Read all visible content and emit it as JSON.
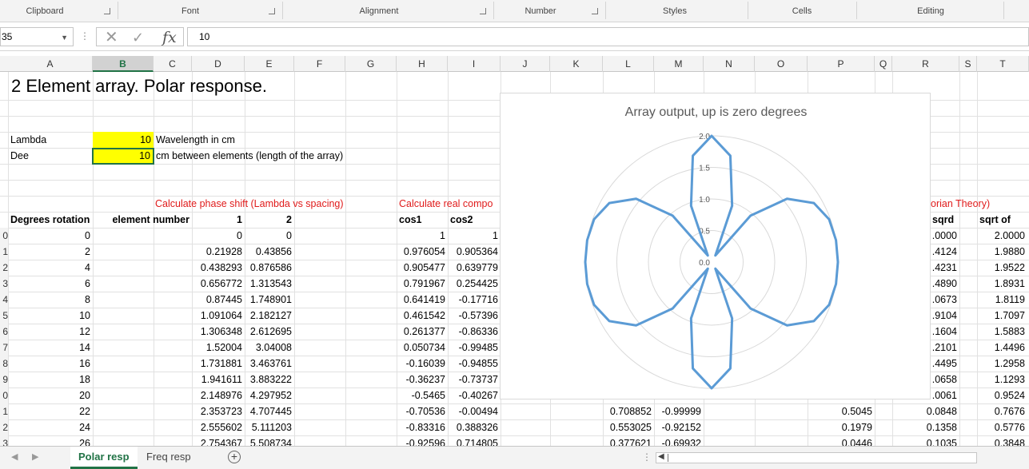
{
  "ribbon": {
    "groups": [
      "Clipboard",
      "Font",
      "Alignment",
      "Number",
      "Styles",
      "Cells",
      "Editing"
    ]
  },
  "formula_bar": {
    "name_box": "35",
    "value": "10",
    "fx": "fx"
  },
  "columns": [
    "A",
    "B",
    "C",
    "D",
    "E",
    "F",
    "G",
    "H",
    "I",
    "J",
    "K",
    "L",
    "M",
    "N",
    "O",
    "P",
    "Q",
    "R",
    "S",
    "T"
  ],
  "sheet": {
    "title": "2 Element array.  Polar response.",
    "lambda_label": "Lambda",
    "lambda_value": "10",
    "lambda_desc": "Wavelength in cm",
    "dee_label": "Dee",
    "dee_value": "10",
    "dee_desc": "cm between elements  (length of the array)",
    "phase_heading": "Calculate phase shift (Lambda vs spacing)",
    "real_heading": "Calculate real compo",
    "theory_heading": "orian Theory)",
    "headers": {
      "degrees": "Degrees rotation",
      "element": "element number",
      "d": "1",
      "e": "2",
      "h": "cos1",
      "i": "cos2",
      "r": "sqrd",
      "t": "sqrt of"
    },
    "row_numbers": [
      "0",
      "1",
      "2",
      "3",
      "4",
      "5",
      "6",
      "7",
      "8",
      "9",
      "0",
      "1",
      "2",
      "3"
    ],
    "rows": [
      {
        "a": "0",
        "d": "0",
        "e": "0",
        "h": "1",
        "i": "1",
        "l": "",
        "m": "",
        "p": "",
        "r": ".0000",
        "t": "2.0000"
      },
      {
        "a": "2",
        "d": "0.21928",
        "e": "0.43856",
        "h": "0.976054",
        "i": "0.905364",
        "l": "",
        "m": "",
        "p": "",
        "r": ".4124",
        "t": "1.9880"
      },
      {
        "a": "4",
        "d": "0.438293",
        "e": "0.876586",
        "h": "0.905477",
        "i": "0.639779",
        "l": "",
        "m": "",
        "p": "",
        "r": ".4231",
        "t": "1.9522"
      },
      {
        "a": "6",
        "d": "0.656772",
        "e": "1.313543",
        "h": "0.791967",
        "i": "0.254425",
        "l": "",
        "m": "",
        "p": "",
        "r": ".4890",
        "t": "1.8931"
      },
      {
        "a": "8",
        "d": "0.87445",
        "e": "1.748901",
        "h": "0.641419",
        "i": "-0.17716",
        "l": "",
        "m": "",
        "p": "",
        "r": ".0673",
        "t": "1.8119"
      },
      {
        "a": "10",
        "d": "1.091064",
        "e": "2.182127",
        "h": "0.461542",
        "i": "-0.57396",
        "l": "",
        "m": "",
        "p": "",
        "r": ".9104",
        "t": "1.7097"
      },
      {
        "a": "12",
        "d": "1.306348",
        "e": "2.612695",
        "h": "0.261377",
        "i": "-0.86336",
        "l": "",
        "m": "",
        "p": "",
        "r": ".1604",
        "t": "1.5883"
      },
      {
        "a": "14",
        "d": "1.52004",
        "e": "3.04008",
        "h": "0.050734",
        "i": "-0.99485",
        "l": "",
        "m": "",
        "p": "",
        "r": ".2101",
        "t": "1.4496"
      },
      {
        "a": "16",
        "d": "1.731881",
        "e": "3.463761",
        "h": "-0.16039",
        "i": "-0.94855",
        "l": "",
        "m": "",
        "p": "",
        "r": ".4495",
        "t": "1.2958"
      },
      {
        "a": "18",
        "d": "1.941611",
        "e": "3.883222",
        "h": "-0.36237",
        "i": "-0.73737",
        "l": "",
        "m": "",
        "p": "",
        "r": ".0658",
        "t": "1.1293"
      },
      {
        "a": "20",
        "d": "2.148976",
        "e": "4.297952",
        "h": "-0.5465",
        "i": "-0.40267",
        "l": "",
        "m": "",
        "p": "",
        "r": ".0061",
        "t": "0.9524"
      },
      {
        "a": "22",
        "d": "2.353723",
        "e": "4.707445",
        "h": "-0.70536",
        "i": "-0.00494",
        "l": "0.708852",
        "m": "-0.99999",
        "p": "0.5045",
        "r": "0.0848",
        "t": "0.7676"
      },
      {
        "a": "24",
        "d": "2.555602",
        "e": "5.111203",
        "h": "-0.83316",
        "i": "0.388326",
        "l": "0.553025",
        "m": "-0.92152",
        "p": "0.1979",
        "r": "0.1358",
        "t": "0.5776"
      },
      {
        "a": "26",
        "d": "2.754367",
        "e": "5.508734",
        "h": "-0.92596",
        "i": "0.714805",
        "l": "0.377621",
        "m": "-0.69932",
        "p": "0.0446",
        "r": "0.1035",
        "t": "0.3848"
      }
    ]
  },
  "chart_data": {
    "type": "line",
    "subtype": "radar",
    "title": "Array output, up is zero degrees",
    "radial_ticks": [
      "0.0",
      "0.5",
      "1.0",
      "1.5",
      "2.0"
    ],
    "rlim": [
      0,
      2
    ],
    "grid": true,
    "legend": "none",
    "line_color": "#5b9bd5",
    "series": [
      {
        "theta_deg": [
          0,
          10,
          20,
          30,
          40,
          50,
          60,
          70,
          80,
          90,
          100,
          110,
          120,
          130,
          140,
          150,
          160,
          170,
          180,
          190,
          200,
          210,
          220,
          230,
          240,
          250,
          260,
          270,
          280,
          290,
          300,
          310,
          320,
          330,
          340,
          350,
          360
        ],
        "r": [
          2.0,
          1.71,
          0.95,
          0.12,
          0.96,
          1.56,
          1.87,
          1.98,
          2.0,
          2.0,
          2.0,
          1.98,
          1.87,
          1.56,
          0.96,
          0.12,
          0.95,
          1.71,
          2.0,
          1.71,
          0.95,
          0.12,
          0.96,
          1.56,
          1.87,
          1.98,
          2.0,
          2.0,
          2.0,
          1.98,
          1.87,
          1.56,
          0.96,
          0.12,
          0.95,
          1.71,
          2.0
        ]
      }
    ]
  },
  "tabs": {
    "active": "Polar resp",
    "other": "Freq resp",
    "add": "+"
  },
  "misc": {
    "dots": "⋮"
  }
}
